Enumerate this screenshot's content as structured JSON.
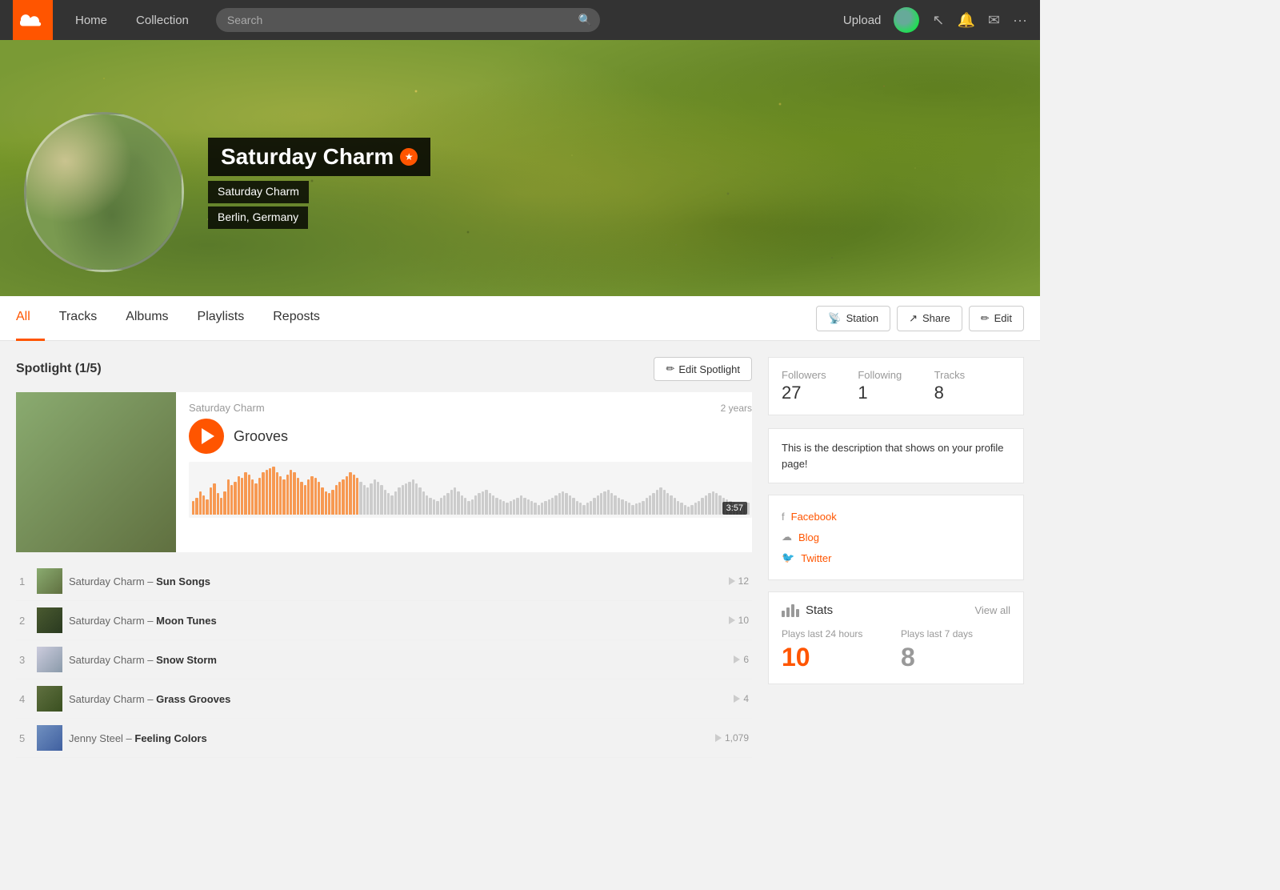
{
  "nav": {
    "home_label": "Home",
    "collection_label": "Collection",
    "search_placeholder": "Search",
    "upload_label": "Upload",
    "more_icon": "···"
  },
  "hero": {
    "artist_name": "Saturday Charm",
    "sub_name": "Saturday Charm",
    "location": "Berlin, Germany",
    "pro_badge": "★"
  },
  "tabs": {
    "all": "All",
    "tracks": "Tracks",
    "albums": "Albums",
    "playlists": "Playlists",
    "reposts": "Reposts",
    "station_label": "Station",
    "share_label": "Share",
    "edit_label": "Edit"
  },
  "spotlight": {
    "title": "Spotlight (1/5)",
    "edit_btn": "Edit Spotlight",
    "track_artist": "Saturday Charm",
    "track_age": "2 years",
    "track_name": "Grooves",
    "track_duration": "3:57"
  },
  "track_list": [
    {
      "num": "1",
      "artist": "Saturday Charm",
      "separator": "–",
      "title": "Sun Songs",
      "plays": "12",
      "thumb_class": "thumb-green"
    },
    {
      "num": "2",
      "artist": "Saturday Charm",
      "separator": "–",
      "title": "Moon Tunes",
      "plays": "10",
      "thumb_class": "thumb-dark"
    },
    {
      "num": "3",
      "artist": "Saturday Charm",
      "separator": "–",
      "title": "Snow Storm",
      "plays": "6",
      "thumb_class": "thumb-snow"
    },
    {
      "num": "4",
      "artist": "Saturday Charm",
      "separator": "–",
      "title": "Grass Grooves",
      "plays": "4",
      "thumb_class": "thumb-grass"
    },
    {
      "num": "5",
      "artist": "Jenny Steel",
      "separator": "–",
      "title": "Feeling Colors",
      "plays": "1,079",
      "thumb_class": "thumb-colors"
    }
  ],
  "right_col": {
    "followers_label": "Followers",
    "followers_value": "27",
    "following_label": "Following",
    "following_value": "1",
    "tracks_label": "Tracks",
    "tracks_value": "8",
    "bio": "This is the description that shows on your profile page!",
    "facebook_label": "Facebook",
    "blog_label": "Blog",
    "twitter_label": "Twitter",
    "stats_title": "Stats",
    "view_all_label": "View all",
    "plays_24h_label": "Plays last 24 hours",
    "plays_24h_value": "10",
    "plays_7d_label": "Plays last 7 days",
    "plays_7d_value": "8"
  },
  "waveform_heights": [
    18,
    22,
    30,
    25,
    20,
    35,
    40,
    28,
    22,
    30,
    45,
    38,
    42,
    50,
    48,
    55,
    52,
    45,
    40,
    48,
    55,
    58,
    60,
    62,
    55,
    50,
    45,
    52,
    58,
    55,
    48,
    42,
    38,
    45,
    50,
    48,
    42,
    35,
    30,
    28,
    32,
    38,
    42,
    45,
    50,
    55,
    52,
    48,
    42,
    38,
    35,
    40,
    45,
    42,
    38,
    32,
    28,
    25,
    30,
    35,
    38,
    40,
    42,
    45,
    40,
    35,
    30,
    25,
    22,
    20,
    18,
    22,
    25,
    28,
    32,
    35,
    30,
    25,
    22,
    18,
    20,
    25,
    28,
    30,
    32,
    28,
    25,
    22,
    20,
    18,
    15,
    18,
    20,
    22,
    25,
    22,
    20,
    18,
    15,
    12,
    15,
    18,
    20,
    22,
    25,
    28,
    30,
    28,
    25,
    22,
    18,
    15,
    12,
    15,
    18,
    22,
    25,
    28,
    30,
    32,
    28,
    25,
    22,
    20,
    18,
    15,
    12,
    14,
    16,
    18,
    22,
    25,
    28,
    32,
    35,
    32,
    28,
    25,
    22,
    18,
    15,
    12,
    10,
    12,
    15,
    18,
    22,
    25,
    28,
    30,
    28,
    25,
    22,
    20,
    18,
    15,
    12,
    10,
    12,
    15
  ]
}
